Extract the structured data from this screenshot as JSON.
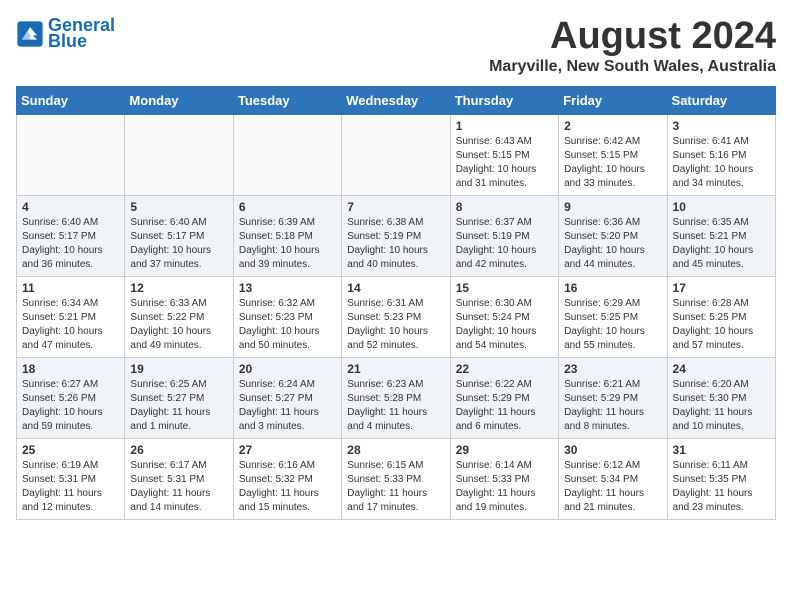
{
  "header": {
    "logo_line1": "General",
    "logo_line2": "Blue",
    "month_year": "August 2024",
    "location": "Maryville, New South Wales, Australia"
  },
  "weekdays": [
    "Sunday",
    "Monday",
    "Tuesday",
    "Wednesday",
    "Thursday",
    "Friday",
    "Saturday"
  ],
  "weeks": [
    [
      {
        "day": "",
        "info": ""
      },
      {
        "day": "",
        "info": ""
      },
      {
        "day": "",
        "info": ""
      },
      {
        "day": "",
        "info": ""
      },
      {
        "day": "1",
        "info": "Sunrise: 6:43 AM\nSunset: 5:15 PM\nDaylight: 10 hours and 31 minutes."
      },
      {
        "day": "2",
        "info": "Sunrise: 6:42 AM\nSunset: 5:15 PM\nDaylight: 10 hours and 33 minutes."
      },
      {
        "day": "3",
        "info": "Sunrise: 6:41 AM\nSunset: 5:16 PM\nDaylight: 10 hours and 34 minutes."
      }
    ],
    [
      {
        "day": "4",
        "info": "Sunrise: 6:40 AM\nSunset: 5:17 PM\nDaylight: 10 hours and 36 minutes."
      },
      {
        "day": "5",
        "info": "Sunrise: 6:40 AM\nSunset: 5:17 PM\nDaylight: 10 hours and 37 minutes."
      },
      {
        "day": "6",
        "info": "Sunrise: 6:39 AM\nSunset: 5:18 PM\nDaylight: 10 hours and 39 minutes."
      },
      {
        "day": "7",
        "info": "Sunrise: 6:38 AM\nSunset: 5:19 PM\nDaylight: 10 hours and 40 minutes."
      },
      {
        "day": "8",
        "info": "Sunrise: 6:37 AM\nSunset: 5:19 PM\nDaylight: 10 hours and 42 minutes."
      },
      {
        "day": "9",
        "info": "Sunrise: 6:36 AM\nSunset: 5:20 PM\nDaylight: 10 hours and 44 minutes."
      },
      {
        "day": "10",
        "info": "Sunrise: 6:35 AM\nSunset: 5:21 PM\nDaylight: 10 hours and 45 minutes."
      }
    ],
    [
      {
        "day": "11",
        "info": "Sunrise: 6:34 AM\nSunset: 5:21 PM\nDaylight: 10 hours and 47 minutes."
      },
      {
        "day": "12",
        "info": "Sunrise: 6:33 AM\nSunset: 5:22 PM\nDaylight: 10 hours and 49 minutes."
      },
      {
        "day": "13",
        "info": "Sunrise: 6:32 AM\nSunset: 5:23 PM\nDaylight: 10 hours and 50 minutes."
      },
      {
        "day": "14",
        "info": "Sunrise: 6:31 AM\nSunset: 5:23 PM\nDaylight: 10 hours and 52 minutes."
      },
      {
        "day": "15",
        "info": "Sunrise: 6:30 AM\nSunset: 5:24 PM\nDaylight: 10 hours and 54 minutes."
      },
      {
        "day": "16",
        "info": "Sunrise: 6:29 AM\nSunset: 5:25 PM\nDaylight: 10 hours and 55 minutes."
      },
      {
        "day": "17",
        "info": "Sunrise: 6:28 AM\nSunset: 5:25 PM\nDaylight: 10 hours and 57 minutes."
      }
    ],
    [
      {
        "day": "18",
        "info": "Sunrise: 6:27 AM\nSunset: 5:26 PM\nDaylight: 10 hours and 59 minutes."
      },
      {
        "day": "19",
        "info": "Sunrise: 6:25 AM\nSunset: 5:27 PM\nDaylight: 11 hours and 1 minute."
      },
      {
        "day": "20",
        "info": "Sunrise: 6:24 AM\nSunset: 5:27 PM\nDaylight: 11 hours and 3 minutes."
      },
      {
        "day": "21",
        "info": "Sunrise: 6:23 AM\nSunset: 5:28 PM\nDaylight: 11 hours and 4 minutes."
      },
      {
        "day": "22",
        "info": "Sunrise: 6:22 AM\nSunset: 5:29 PM\nDaylight: 11 hours and 6 minutes."
      },
      {
        "day": "23",
        "info": "Sunrise: 6:21 AM\nSunset: 5:29 PM\nDaylight: 11 hours and 8 minutes."
      },
      {
        "day": "24",
        "info": "Sunrise: 6:20 AM\nSunset: 5:30 PM\nDaylight: 11 hours and 10 minutes."
      }
    ],
    [
      {
        "day": "25",
        "info": "Sunrise: 6:19 AM\nSunset: 5:31 PM\nDaylight: 11 hours and 12 minutes."
      },
      {
        "day": "26",
        "info": "Sunrise: 6:17 AM\nSunset: 5:31 PM\nDaylight: 11 hours and 14 minutes."
      },
      {
        "day": "27",
        "info": "Sunrise: 6:16 AM\nSunset: 5:32 PM\nDaylight: 11 hours and 15 minutes."
      },
      {
        "day": "28",
        "info": "Sunrise: 6:15 AM\nSunset: 5:33 PM\nDaylight: 11 hours and 17 minutes."
      },
      {
        "day": "29",
        "info": "Sunrise: 6:14 AM\nSunset: 5:33 PM\nDaylight: 11 hours and 19 minutes."
      },
      {
        "day": "30",
        "info": "Sunrise: 6:12 AM\nSunset: 5:34 PM\nDaylight: 11 hours and 21 minutes."
      },
      {
        "day": "31",
        "info": "Sunrise: 6:11 AM\nSunset: 5:35 PM\nDaylight: 11 hours and 23 minutes."
      }
    ]
  ]
}
